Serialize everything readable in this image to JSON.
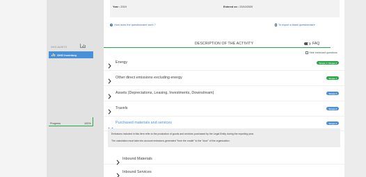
{
  "sidebar": {
    "section_label": "GHG AUDITS",
    "chart_icon": "bar-chart-icon",
    "active_item": {
      "label": "GHG Inventory",
      "icon": "bar-chart-icon"
    },
    "progress": {
      "label": "Progress",
      "value": "100%",
      "fraction": 1.0
    }
  },
  "info": {
    "year_label": "Year :",
    "year_value": "2019",
    "entered_label": "Entered on :",
    "entered_value": "23/10/2020"
  },
  "links": {
    "help": "How does the questionnaire work ?",
    "export": "To export a blank questionnaire"
  },
  "section": {
    "title": "DESCRIPTION OF THE ACTIVITY",
    "faq": "FAQ",
    "hide_irrelevant": "Hide irrelevant questions"
  },
  "categories": [
    {
      "label": "Energy",
      "badge": "Scope 1 / Scope 2",
      "badge_color": "#28a745",
      "icon": "chevron-right-icon"
    },
    {
      "label": "Other direct emissions excluding energy",
      "badge": "Scope 1",
      "badge_color": "#28a745",
      "icon": "chevron-right-icon"
    },
    {
      "label": "Assets (Depreciations, Leasing, Investments, Downstream)",
      "badge": "Scope 3",
      "badge_color": "#4a90d9",
      "icon": "chevron-right-icon"
    },
    {
      "label": "Travels",
      "badge": "Scope 3",
      "badge_color": "#4a90d9",
      "icon": "chevron-right-icon"
    },
    {
      "label": "Purchased materials and services",
      "badge": "Scope 3",
      "badge_color": "#4a90d9",
      "icon": "chevron-down-icon",
      "expanded": true
    }
  ],
  "expanded_description": {
    "p1": "Emissions included in this item refer to the production of goods and services purchased by the Legal Entity during the reporting year.",
    "p2": "The calculation must take into account emissions generated \"from the cradle\" to the \"door\" of the organization."
  },
  "subcategories": [
    {
      "label": "Inbound Materials",
      "icon": "chevron-right-icon"
    },
    {
      "label": "Inbound Services",
      "icon": "chevron-right-icon"
    }
  ],
  "colors": {
    "accent_blue": "#4a90d9",
    "accent_green": "#28a745",
    "link_blue": "#3d6fb3"
  }
}
